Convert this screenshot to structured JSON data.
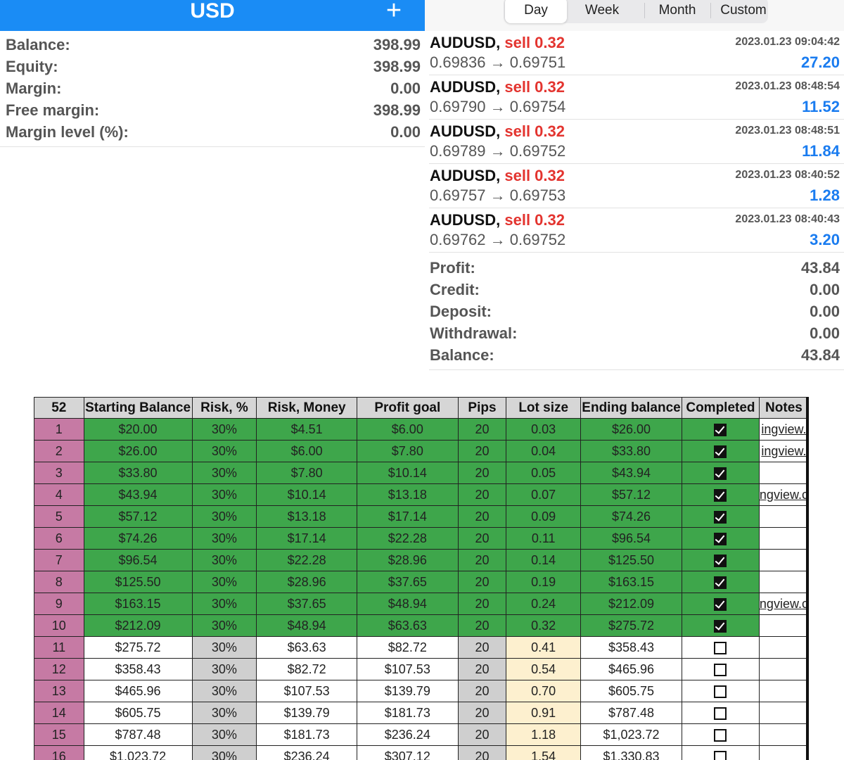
{
  "account": {
    "currency": "USD",
    "add_symbol": "+",
    "rows": [
      {
        "label": "Balance:",
        "value": "398.99"
      },
      {
        "label": "Equity:",
        "value": "398.99"
      },
      {
        "label": "Margin:",
        "value": "0.00"
      },
      {
        "label": "Free margin:",
        "value": "398.99"
      },
      {
        "label": "Margin level (%):",
        "value": "0.00"
      }
    ]
  },
  "history": {
    "tabs": [
      "Day",
      "Week",
      "Month",
      "Custom"
    ],
    "active_tab": "Day",
    "deals": [
      {
        "symbol": "AUDUSD,",
        "type": "sell 0.32",
        "time": "2023.01.23 09:04:42",
        "prices": "0.69836 → 0.69751",
        "profit": "27.20"
      },
      {
        "symbol": "AUDUSD,",
        "type": "sell 0.32",
        "time": "2023.01.23 08:48:54",
        "prices": "0.69790 → 0.69754",
        "profit": "11.52"
      },
      {
        "symbol": "AUDUSD,",
        "type": "sell 0.32",
        "time": "2023.01.23 08:48:51",
        "prices": "0.69789 → 0.69752",
        "profit": "11.84"
      },
      {
        "symbol": "AUDUSD,",
        "type": "sell 0.32",
        "time": "2023.01.23 08:40:52",
        "prices": "0.69757 → 0.69753",
        "profit": "1.28"
      },
      {
        "symbol": "AUDUSD,",
        "type": "sell 0.32",
        "time": "2023.01.23 08:40:43",
        "prices": "0.69762 → 0.69752",
        "profit": "3.20"
      }
    ],
    "summary": [
      {
        "label": "Profit:",
        "value": "43.84"
      },
      {
        "label": "Credit:",
        "value": "0.00"
      },
      {
        "label": "Deposit:",
        "value": "0.00"
      },
      {
        "label": "Withdrawal:",
        "value": "0.00"
      },
      {
        "label": "Balance:",
        "value": "43.84"
      }
    ]
  },
  "sheet": {
    "headers": [
      "52",
      "Starting Balance",
      "Risk, %",
      "Risk, Money",
      "Profit goal",
      "Pips",
      "Lot size",
      "Ending balance",
      "Completed",
      "Notes"
    ],
    "colors": {
      "index": "#c67aa4",
      "done": "#3ea64b",
      "grey": "#cfcfcf",
      "peach": "#fdf0cf"
    },
    "rows": [
      {
        "n": "1",
        "start": "$20.00",
        "risk_pct": "30%",
        "risk_money": "$4.51",
        "goal": "$6.00",
        "pips": "20",
        "lot": "0.03",
        "end": "$26.00",
        "completed": true,
        "notes": "ingview."
      },
      {
        "n": "2",
        "start": "$26.00",
        "risk_pct": "30%",
        "risk_money": "$6.00",
        "goal": "$7.80",
        "pips": "20",
        "lot": "0.04",
        "end": "$33.80",
        "completed": true,
        "notes": "ingview."
      },
      {
        "n": "3",
        "start": "$33.80",
        "risk_pct": "30%",
        "risk_money": "$7.80",
        "goal": "$10.14",
        "pips": "20",
        "lot": "0.05",
        "end": "$43.94",
        "completed": true,
        "notes": ""
      },
      {
        "n": "4",
        "start": "$43.94",
        "risk_pct": "30%",
        "risk_money": "$10.14",
        "goal": "$13.18",
        "pips": "20",
        "lot": "0.07",
        "end": "$57.12",
        "completed": true,
        "notes": "ngview.c"
      },
      {
        "n": "5",
        "start": "$57.12",
        "risk_pct": "30%",
        "risk_money": "$13.18",
        "goal": "$17.14",
        "pips": "20",
        "lot": "0.09",
        "end": "$74.26",
        "completed": true,
        "notes": ""
      },
      {
        "n": "6",
        "start": "$74.26",
        "risk_pct": "30%",
        "risk_money": "$17.14",
        "goal": "$22.28",
        "pips": "20",
        "lot": "0.11",
        "end": "$96.54",
        "completed": true,
        "notes": ""
      },
      {
        "n": "7",
        "start": "$96.54",
        "risk_pct": "30%",
        "risk_money": "$22.28",
        "goal": "$28.96",
        "pips": "20",
        "lot": "0.14",
        "end": "$125.50",
        "completed": true,
        "notes": ""
      },
      {
        "n": "8",
        "start": "$125.50",
        "risk_pct": "30%",
        "risk_money": "$28.96",
        "goal": "$37.65",
        "pips": "20",
        "lot": "0.19",
        "end": "$163.15",
        "completed": true,
        "notes": ""
      },
      {
        "n": "9",
        "start": "$163.15",
        "risk_pct": "30%",
        "risk_money": "$37.65",
        "goal": "$48.94",
        "pips": "20",
        "lot": "0.24",
        "end": "$212.09",
        "completed": true,
        "notes": "ngview.c"
      },
      {
        "n": "10",
        "start": "$212.09",
        "risk_pct": "30%",
        "risk_money": "$48.94",
        "goal": "$63.63",
        "pips": "20",
        "lot": "0.32",
        "end": "$275.72",
        "completed": true,
        "notes": ""
      },
      {
        "n": "11",
        "start": "$275.72",
        "risk_pct": "30%",
        "risk_money": "$63.63",
        "goal": "$82.72",
        "pips": "20",
        "lot": "0.41",
        "end": "$358.43",
        "completed": false,
        "notes": ""
      },
      {
        "n": "12",
        "start": "$358.43",
        "risk_pct": "30%",
        "risk_money": "$82.72",
        "goal": "$107.53",
        "pips": "20",
        "lot": "0.54",
        "end": "$465.96",
        "completed": false,
        "notes": ""
      },
      {
        "n": "13",
        "start": "$465.96",
        "risk_pct": "30%",
        "risk_money": "$107.53",
        "goal": "$139.79",
        "pips": "20",
        "lot": "0.70",
        "end": "$605.75",
        "completed": false,
        "notes": ""
      },
      {
        "n": "14",
        "start": "$605.75",
        "risk_pct": "30%",
        "risk_money": "$139.79",
        "goal": "$181.73",
        "pips": "20",
        "lot": "0.91",
        "end": "$787.48",
        "completed": false,
        "notes": ""
      },
      {
        "n": "15",
        "start": "$787.48",
        "risk_pct": "30%",
        "risk_money": "$181.73",
        "goal": "$236.24",
        "pips": "20",
        "lot": "1.18",
        "end": "$1,023.72",
        "completed": false,
        "notes": ""
      },
      {
        "n": "16",
        "start": "$1,023.72",
        "risk_pct": "30%",
        "risk_money": "$236.24",
        "goal": "$307.12",
        "pips": "20",
        "lot": "1.54",
        "end": "$1,330.83",
        "completed": false,
        "notes": ""
      }
    ]
  }
}
